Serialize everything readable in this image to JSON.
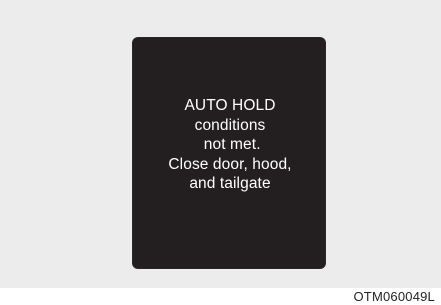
{
  "display": {
    "message_lines": [
      "AUTO HOLD",
      "conditions",
      " not met.",
      "Close door, hood,",
      "and tailgate"
    ]
  },
  "figure_code": "OTM060049L",
  "colors": {
    "background": "#ececec",
    "display": "#231f20",
    "text": "#ffffff"
  }
}
